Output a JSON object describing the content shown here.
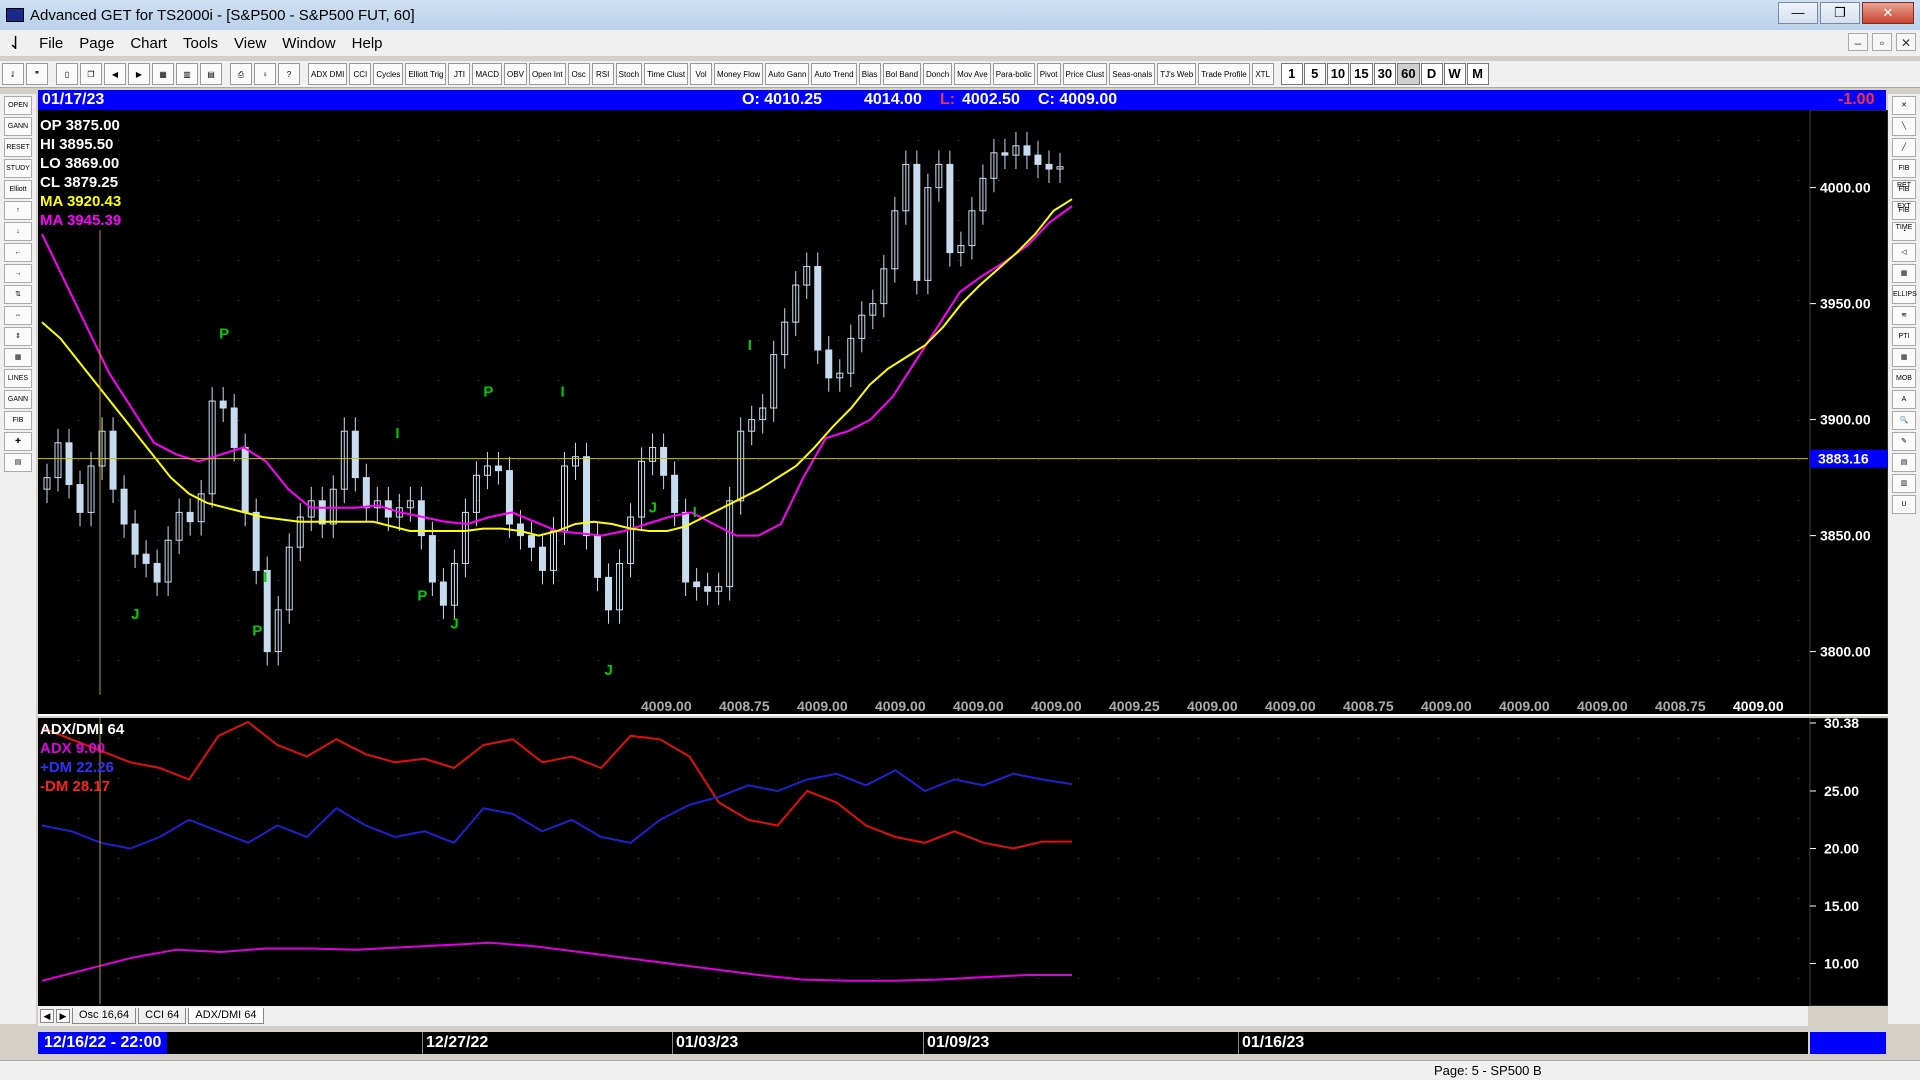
{
  "window": {
    "title": "Advanced GET for TS2000i - [S&P500 - S&P500 FUT, 60]",
    "controls": [
      "—",
      "❐",
      "✕"
    ]
  },
  "menu": [
    "File",
    "Page",
    "Chart",
    "Tools",
    "View",
    "Window",
    "Help"
  ],
  "mdi_controls": [
    "–",
    "▫",
    "✕"
  ],
  "toolbar": {
    "study_buttons": [
      "ADX DMI",
      "CCI",
      "Cycles",
      "Elliott Trig",
      "JTI",
      "MACD",
      "OBV",
      "Open Int",
      "Osc",
      "RSI",
      "Stoch",
      "Time Clust",
      "Vol",
      "Money Flow",
      "Auto Gann",
      "Auto Trend",
      "Bias",
      "Bol Band",
      "Donch",
      "Mov Ave",
      "Para-bolic",
      "Pivot",
      "Price Clust",
      "Seas-onals",
      "TJ's Web",
      "Trade Profile",
      "XTL"
    ],
    "periods": [
      "1",
      "5",
      "10",
      "15",
      "30",
      "60",
      "D",
      "W",
      "M"
    ],
    "active_period": "60"
  },
  "left_tools": [
    "OPEN",
    "GANN",
    "RESET",
    "STUDY",
    "Elliott",
    "↑",
    "↓",
    "←",
    "→",
    "⇅",
    "⇔",
    "⇕",
    "▦",
    "LINES",
    "GANN",
    "FIB",
    "✚",
    "▤"
  ],
  "right_tools": [
    "✕",
    "╲",
    "╱",
    "FIB RET",
    "FIB EXT",
    "FIB TIME",
    "◔",
    "◁",
    "▦",
    "ELLIPS",
    "≋",
    "PTI",
    "▦",
    "MOB",
    "A",
    "🔍",
    "✎",
    "▤",
    "▥",
    "U"
  ],
  "infobar": {
    "date": "01/17/23",
    "open": "O: 4010.25",
    "high": "4014.00",
    "low_label": "L:",
    "low": "4002.50",
    "close": "C: 4009.00",
    "change": "-1.00"
  },
  "legend": {
    "op": "OP  3875.00",
    "hi": "HI   3895.50",
    "lo": "LO  3869.00",
    "cl": "CL  3879.25",
    "ma1": "MA  3920.43",
    "ma2": "MA  3945.39"
  },
  "dmi_legend": {
    "title": "ADX/DMI 64",
    "adx": "ADX 9.00",
    "pdm": "+DM 22.26",
    "mdm": "-DM  28.17"
  },
  "tabs": [
    "Osc 16,64",
    "CCI 64",
    "ADX/DMI 64"
  ],
  "active_tab": "ADX/DMI 64",
  "dates": {
    "start": "12/16/22 - 22:00",
    "labels": [
      "12/27/22",
      "01/03/23",
      "01/09/23",
      "01/16/23"
    ]
  },
  "statusbar": {
    "page": "Page: 5 - SP500 B"
  },
  "colors": {
    "background": "#000000",
    "candle": "#c8dcf0",
    "ma_fast": "#ffff00",
    "ma_slow": "#ff00ff",
    "adx": "#e000e0",
    "pdm": "#2020d0",
    "mdm": "#e01010",
    "pivot": "#00cc00",
    "infobar": "#0000ff"
  },
  "chart_data": {
    "type": "candlestick",
    "price_axis": {
      "ticks": [
        "4000.00",
        "3950.00",
        "3900.00",
        "3850.00",
        "3800.00"
      ],
      "ylim": [
        3780,
        4030
      ],
      "cursor_price": "3883.16",
      "cursor_level": 3883.16
    },
    "bottom_price_labels": [
      "4009.00",
      "4008.75",
      "4009.00",
      "4009.00",
      "4009.00",
      "4009.00",
      "4009.25",
      "4009.00",
      "4009.00",
      "4008.75",
      "4009.00",
      "4009.00",
      "4009.00",
      "4008.75",
      "4009.00"
    ],
    "closes": [
      3875,
      3890,
      3872,
      3860,
      3880,
      3895,
      3870,
      3855,
      3842,
      3838,
      3830,
      3848,
      3860,
      3856,
      3868,
      3908,
      3905,
      3888,
      3860,
      3835,
      3800,
      3818,
      3845,
      3858,
      3865,
      3855,
      3870,
      3895,
      3875,
      3862,
      3865,
      3858,
      3862,
      3865,
      3850,
      3830,
      3820,
      3838,
      3860,
      3876,
      3880,
      3878,
      3855,
      3850,
      3845,
      3835,
      3852,
      3880,
      3884,
      3850,
      3832,
      3818,
      3838,
      3858,
      3882,
      3888,
      3876,
      3860,
      3830,
      3828,
      3826,
      3828,
      3865,
      3895,
      3900,
      3905,
      3928,
      3942,
      3958,
      3966,
      3930,
      3918,
      3920,
      3935,
      3945,
      3950,
      3965,
      3990,
      4010,
      3960,
      4000,
      4010,
      3972,
      3975,
      3990,
      4004,
      4015,
      4014,
      4018,
      4014,
      4010,
      4008,
      4009
    ],
    "ma_fast": [
      3942,
      3935,
      3925,
      3915,
      3905,
      3895,
      3885,
      3875,
      3868,
      3864,
      3862,
      3860,
      3858,
      3857,
      3856,
      3856,
      3856,
      3856,
      3856,
      3854,
      3852,
      3852,
      3852,
      3852,
      3853,
      3853,
      3852,
      3850,
      3852,
      3855,
      3856,
      3855,
      3853,
      3852,
      3852,
      3854,
      3858,
      3862,
      3866,
      3870,
      3875,
      3880,
      3888,
      3897,
      3905,
      3915,
      3922,
      3927,
      3932,
      3940,
      3950,
      3958,
      3965,
      3972,
      3980,
      3990,
      3995
    ],
    "ma_slow": [
      3980,
      3960,
      3940,
      3920,
      3905,
      3890,
      3885,
      3882,
      3885,
      3888,
      3882,
      3870,
      3862,
      3862,
      3862,
      3863,
      3860,
      3858,
      3856,
      3855,
      3858,
      3860,
      3856,
      3852,
      3851,
      3850,
      3852,
      3855,
      3858,
      3860,
      3855,
      3850,
      3850,
      3855,
      3875,
      3892,
      3895,
      3900,
      3910,
      3925,
      3940,
      3955,
      3962,
      3968,
      3975,
      3985,
      3992
    ],
    "pivot_labels": [
      "J",
      "P",
      "P",
      "I",
      "P",
      "I",
      "P",
      "J",
      "I",
      "J",
      "J",
      "I",
      "I"
    ],
    "dmi": {
      "ylim": [
        7,
        31
      ],
      "ticks": [
        "30.38",
        "25.00",
        "20.00",
        "15.00",
        "10.00"
      ],
      "mdm": [
        30.5,
        29.5,
        28.5,
        27.5,
        27.0,
        26.0,
        29.8,
        31.0,
        29.0,
        28.0,
        29.5,
        28.2,
        27.5,
        27.8,
        27.0,
        29.0,
        29.5,
        27.5,
        28.0,
        27.0,
        29.8,
        29.5,
        28.0,
        24.0,
        22.5,
        22.0,
        25.0,
        24.0,
        22.0,
        21.0,
        20.5,
        21.5,
        20.5,
        20.0,
        20.6,
        20.6
      ],
      "pdm": [
        22.0,
        21.5,
        20.5,
        20.0,
        21.0,
        22.5,
        21.5,
        20.5,
        22.0,
        21.0,
        23.5,
        22.0,
        21.0,
        21.5,
        20.5,
        23.5,
        23.0,
        21.5,
        22.5,
        21.0,
        20.5,
        22.5,
        23.8,
        24.5,
        25.5,
        25.0,
        26.0,
        26.5,
        25.5,
        26.8,
        25.0,
        26.0,
        25.5,
        26.5,
        26.0,
        25.6
      ],
      "adx": [
        8.5,
        9.5,
        10.5,
        11.2,
        11.0,
        11.3,
        11.3,
        11.2,
        11.4,
        11.6,
        11.8,
        11.5,
        11.0,
        10.5,
        10.0,
        9.5,
        9.0,
        8.6,
        8.5,
        8.5,
        8.6,
        8.8,
        9.0,
        9.0
      ]
    }
  }
}
